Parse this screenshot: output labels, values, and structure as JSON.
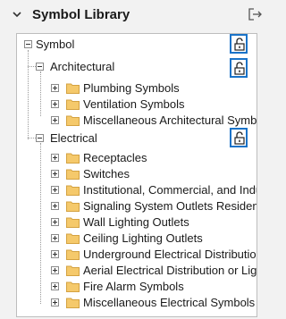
{
  "panel": {
    "title": "Symbol Library"
  },
  "tree": {
    "root": "Symbol",
    "architectural": {
      "label": "Architectural",
      "children": [
        "Plumbing Symbols",
        "Ventilation Symbols",
        "Miscellaneous Architectural Symbols"
      ]
    },
    "electrical": {
      "label": "Electrical",
      "children": [
        "Receptacles",
        "Switches",
        "Institutional, Commercial, and Industrial",
        "Signaling System Outlets Residential",
        "Wall Lighting Outlets",
        "Ceiling Lighting Outlets",
        "Underground Electrical Distribution",
        "Aerial Electrical Distribution or Lighting",
        "Fire Alarm Symbols",
        "Miscellaneous Electrical Symbols"
      ]
    }
  },
  "colors": {
    "accent": "#1a73c8",
    "folder": "#f5c96b",
    "folder_edge": "#d4a241"
  },
  "icons": {
    "header_left": "chevron-down-icon",
    "header_right": "export-icon",
    "lock": "lock-open-icon",
    "folder": "folder-icon"
  }
}
